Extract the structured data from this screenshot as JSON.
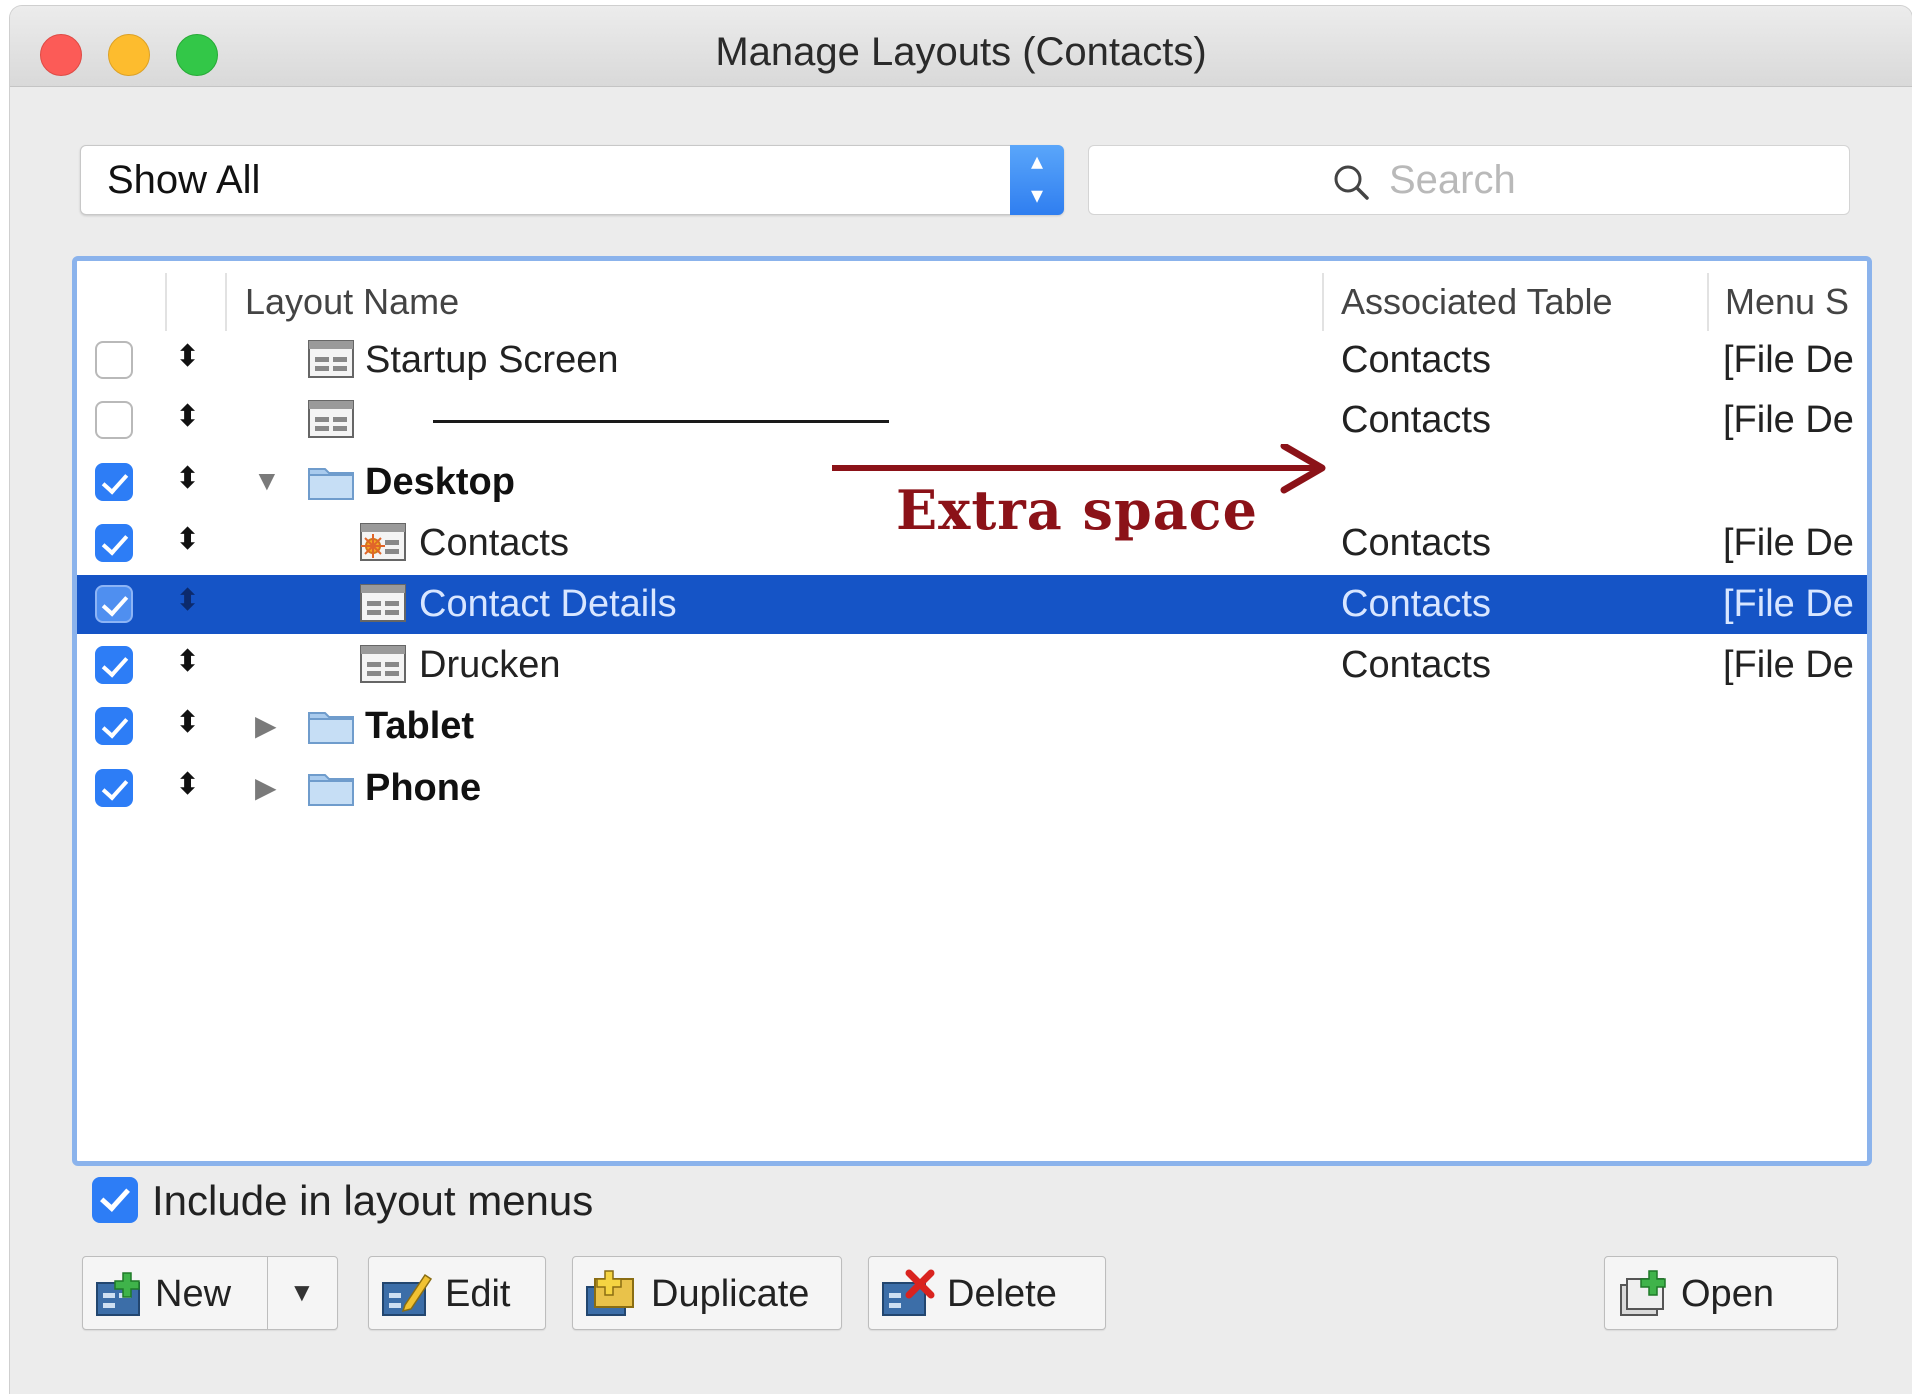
{
  "window": {
    "title": "Manage Layouts (Contacts)"
  },
  "filter": {
    "selected": "Show All"
  },
  "search": {
    "placeholder": "Search"
  },
  "table": {
    "headers": {
      "layout_name": "Layout Name",
      "associated_table": "Associated Table",
      "menu": "Menu S"
    },
    "rows": [
      {
        "checked": false,
        "name": "Startup Screen",
        "assoc": "Contacts",
        "menu": "[File De",
        "type": "layout",
        "bold": false
      },
      {
        "checked": false,
        "name": "",
        "assoc": "Contacts",
        "menu": "[File De",
        "type": "separator",
        "bold": false
      },
      {
        "checked": true,
        "name": "Desktop",
        "assoc": "",
        "menu": "",
        "type": "folder",
        "expanded": true,
        "bold": true
      },
      {
        "checked": true,
        "name": "Contacts",
        "assoc": "Contacts",
        "menu": "[File De",
        "type": "layout-start",
        "bold": false
      },
      {
        "checked": true,
        "name": "Contact Details",
        "assoc": "Contacts",
        "menu": "[File De",
        "type": "layout",
        "bold": false,
        "selected": true
      },
      {
        "checked": true,
        "name": "Drucken",
        "assoc": "Contacts",
        "menu": "[File De",
        "type": "layout",
        "bold": false
      },
      {
        "checked": true,
        "name": "Tablet",
        "assoc": "",
        "menu": "",
        "type": "folder",
        "expanded": false,
        "bold": true
      },
      {
        "checked": true,
        "name": "Phone",
        "assoc": "",
        "menu": "",
        "type": "folder",
        "expanded": false,
        "bold": true
      }
    ]
  },
  "annotation": {
    "text": "Extra space"
  },
  "include_in_menus": {
    "label": "Include in layout menus",
    "checked": true
  },
  "buttons": {
    "new": "New",
    "edit": "Edit",
    "duplicate": "Duplicate",
    "delete": "Delete",
    "open": "Open"
  },
  "colors": {
    "selection": "#1554c6",
    "accent": "#2d7df6",
    "annotation": "#8b1218"
  }
}
